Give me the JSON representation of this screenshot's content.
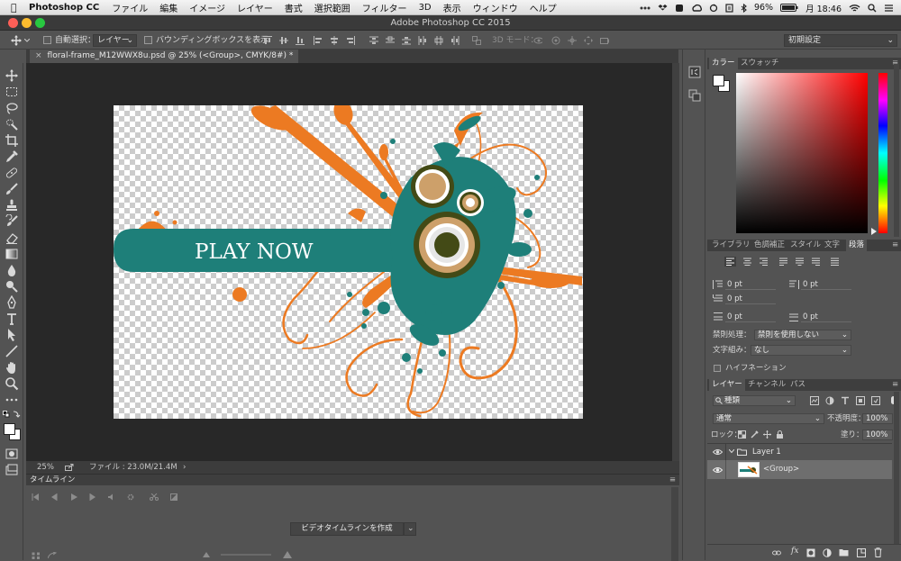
{
  "menubar": {
    "app_name": "Photoshop CC",
    "items": [
      "ファイル",
      "編集",
      "イメージ",
      "レイヤー",
      "書式",
      "選択範囲",
      "フィルター",
      "3D",
      "表示",
      "ウィンドウ",
      "ヘルプ"
    ],
    "battery": "96%",
    "clock": "月 18:46"
  },
  "window": {
    "title": "Adobe Photoshop CC 2015"
  },
  "options": {
    "auto_select_label": "自動選択：",
    "auto_select_value": "レイヤー",
    "bounding_box_label": "バウンディングボックスを表示",
    "mode_3d_label": "3D モード：",
    "workspace": "初期設定"
  },
  "document": {
    "tab_title": "floral-frame_M12WWX8u.psd @ 25% (<Group>, CMYK/8#) *",
    "canvas_text": "PLAY NOW",
    "colors": {
      "teal": "#1e7f79",
      "orange": "#ec7a22",
      "olive": "#434a16",
      "tan": "#cda06a"
    }
  },
  "status": {
    "zoom": "25%",
    "file_info": "ファイル : 23.0M/21.4M"
  },
  "timeline": {
    "title": "タイムライン",
    "create_button": "ビデオタイムラインを作成"
  },
  "color_panel": {
    "tabs": [
      "カラー",
      "スウォッチ"
    ],
    "foreground": "#ffffff",
    "background": "#ffffff",
    "hue_color": "#ff0000"
  },
  "paragraph_panel": {
    "tabs": [
      "ライブラリ",
      "色調補正",
      "スタイル",
      "文字",
      "段落"
    ],
    "indent_left": "0 pt",
    "indent_right": "0 pt",
    "indent_first": "0 pt",
    "space_before": "0 pt",
    "space_after": "0 pt",
    "kinsoku_label": "禁則処理：",
    "kinsoku_value": "禁則を使用しない",
    "mojikumi_label": "文字組み：",
    "mojikumi_value": "なし",
    "hyphenation_label": "ハイフネーション"
  },
  "layers_panel": {
    "tabs": [
      "レイヤー",
      "チャンネル",
      "パス"
    ],
    "filter_kind": "種類",
    "blend_mode": "通常",
    "opacity_label": "不透明度：",
    "opacity_value": "100%",
    "lock_label": "ロック：",
    "fill_label": "塗り：",
    "fill_value": "100%",
    "layers": [
      {
        "name": "Layer 1",
        "type": "group"
      },
      {
        "name": "<Group>",
        "type": "layer"
      }
    ]
  }
}
